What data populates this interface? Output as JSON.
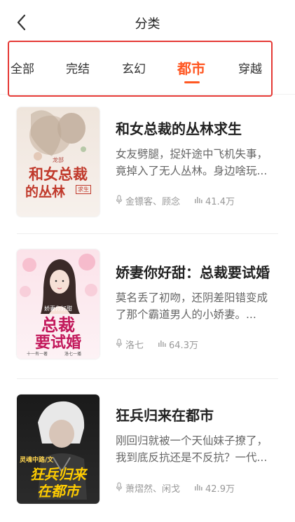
{
  "header": {
    "title": "分类"
  },
  "tabs": [
    {
      "label": "全部"
    },
    {
      "label": "完结"
    },
    {
      "label": "玄幻"
    },
    {
      "label": "都市"
    },
    {
      "label": "穿越"
    }
  ],
  "active_tab": "都市",
  "colors": {
    "accent": "#ff5722",
    "highlight_border": "#e53935"
  },
  "books": [
    {
      "title": "和女总裁的丛林求生",
      "description_line1": "女友劈腿，捉奸途中飞机失事，",
      "description_line2": "竟掉入了无人丛林。身边啥玩...",
      "authors": "金镖客、顾念",
      "listens": "41.4万",
      "cover_text_main": "和女总裁",
      "cover_text_sub": "的丛林",
      "cover_text_tag": "求生",
      "cover_text_top": "龙部"
    },
    {
      "title": "娇妻你好甜：总裁要试婚",
      "description_line1": "莫名丢了初吻，还阴差阳错变成",
      "description_line2": "了那个霸道男人的小娇妻。...",
      "authors": "洛七",
      "listens": "64.3万",
      "cover_text_main": "总裁",
      "cover_text_sub": "要试婚",
      "cover_text_top": "娇妻你好甜",
      "cover_text_bottom_left": "十一有一著",
      "cover_text_bottom_right": "洛七一播"
    },
    {
      "title": "狂兵归来在都市",
      "description_line1": "刚回归就被一个天仙妹子撩了，",
      "description_line2": "我到底反抗还是不反抗？一代...",
      "authors": "萧熠然、闲戈",
      "listens": "42.9万",
      "cover_text_main": "狂兵归来",
      "cover_text_sub": "在都市",
      "cover_text_top": "灵魂中路/文"
    }
  ]
}
